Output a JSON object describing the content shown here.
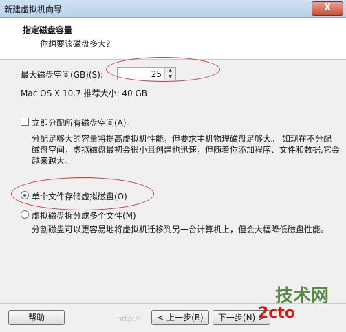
{
  "window": {
    "title": "新建虚拟机向导",
    "close_label": "X"
  },
  "header": {
    "title": "指定磁盘容量",
    "subtitle": "你想要该磁盘多大？"
  },
  "disk": {
    "max_label": "最大磁盘空间(GB)(S):",
    "max_value": "25",
    "recommend_text": "Mac OS X 10.7 推荐大小: 40 GB"
  },
  "allocate": {
    "label": "立即分配所有磁盘空间(A)。",
    "desc_lines": [
      "分配足够大的容量将提高虚拟机性能，但要求主机物理磁盘足够大。 如现在不分配",
      "磁盘空间，虚拟磁盘最初会很小且创建也迅速，但随着你添加程序、文件和数据,它会",
      "越来越大。"
    ]
  },
  "single_file": {
    "label": "单个文件存储虚拟磁盘(O)"
  },
  "split_file": {
    "label": "虚拟磁盘拆分成多个文件(M)",
    "desc": "分割磁盘可以更容易地将虚拟机迁移到另一台计算机上，但会大幅降低磁盘性能。"
  },
  "buttons": {
    "help": "帮助",
    "back": "< 上一步(B)",
    "next": "下一步(N) >"
  },
  "watermarks": {
    "logo": "技术网",
    "red_text": "2cto",
    "url": "http://"
  },
  "colors": {
    "annotation": "#d23a3a",
    "accent": "#1f5fbf"
  }
}
